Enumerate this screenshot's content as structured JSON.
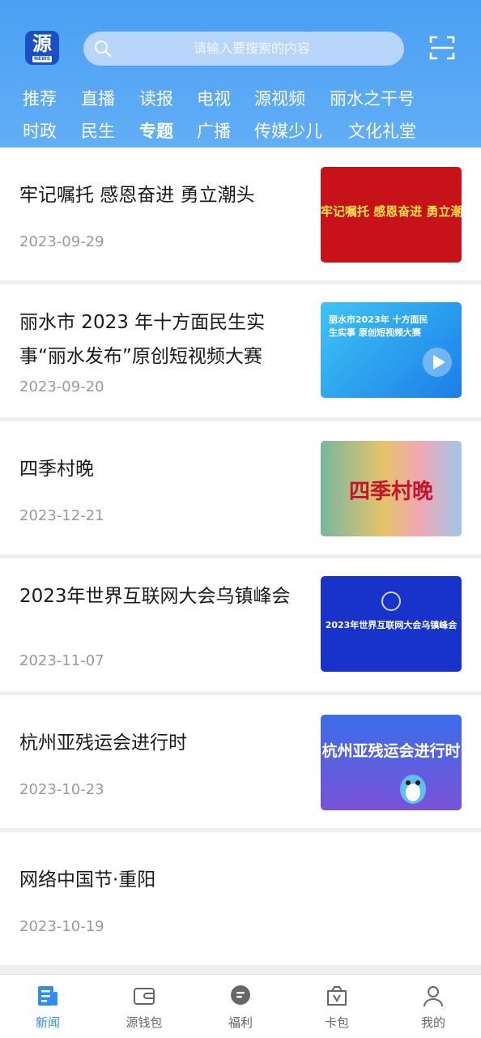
{
  "header": {
    "logo_char": "源",
    "logo_sub": "NEWS",
    "search_placeholder": "请输入要搜索的内容",
    "scan_icon": "scan-icon"
  },
  "channels": {
    "row1": [
      "推荐",
      "直播",
      "读报",
      "电视",
      "源视频",
      "丽水之干号"
    ],
    "row2": [
      "时政",
      "民生",
      "专题",
      "广播",
      "传媒少儿",
      "文化礼堂"
    ],
    "active": "专题"
  },
  "articles": [
    {
      "title": "牢记嘱托 感恩奋进 勇立潮头",
      "date": "2023-09-29",
      "thumb_text": "牢记嘱托  感恩奋进  勇立潮头"
    },
    {
      "title": "丽水市 2023 年十方面民生实事“丽水发布”原创短视频大赛",
      "date": "2023-09-20",
      "thumb_text": "丽水市2023年 十方面民生实事 原创短视频大赛"
    },
    {
      "title": "四季村晚",
      "date": "2023-12-21",
      "thumb_text": "四季村晚"
    },
    {
      "title": "2023年世界互联网大会乌镇峰会",
      "date": "2023-11-07",
      "thumb_text": "2023年世界互联网大会乌镇峰会"
    },
    {
      "title": "杭州亚残运会进行时",
      "date": "2023-10-23",
      "thumb_text": "杭州亚残运会进行时"
    },
    {
      "title": "网络中国节·重阳",
      "date": "2023-10-19",
      "thumb_text": ""
    }
  ],
  "tabbar": {
    "items": [
      {
        "label": "新闻",
        "icon": "news-icon"
      },
      {
        "label": "源钱包",
        "icon": "wallet-icon"
      },
      {
        "label": "福利",
        "icon": "chat-bubble-icon"
      },
      {
        "label": "卡包",
        "icon": "card-bag-icon"
      },
      {
        "label": "我的",
        "icon": "user-icon"
      }
    ],
    "active": "新闻"
  },
  "colors": {
    "header": "#4aa0f4",
    "active_tab": "#2f8ef0",
    "title_text": "#1a1a1a",
    "date_text": "#9a9a9a"
  }
}
